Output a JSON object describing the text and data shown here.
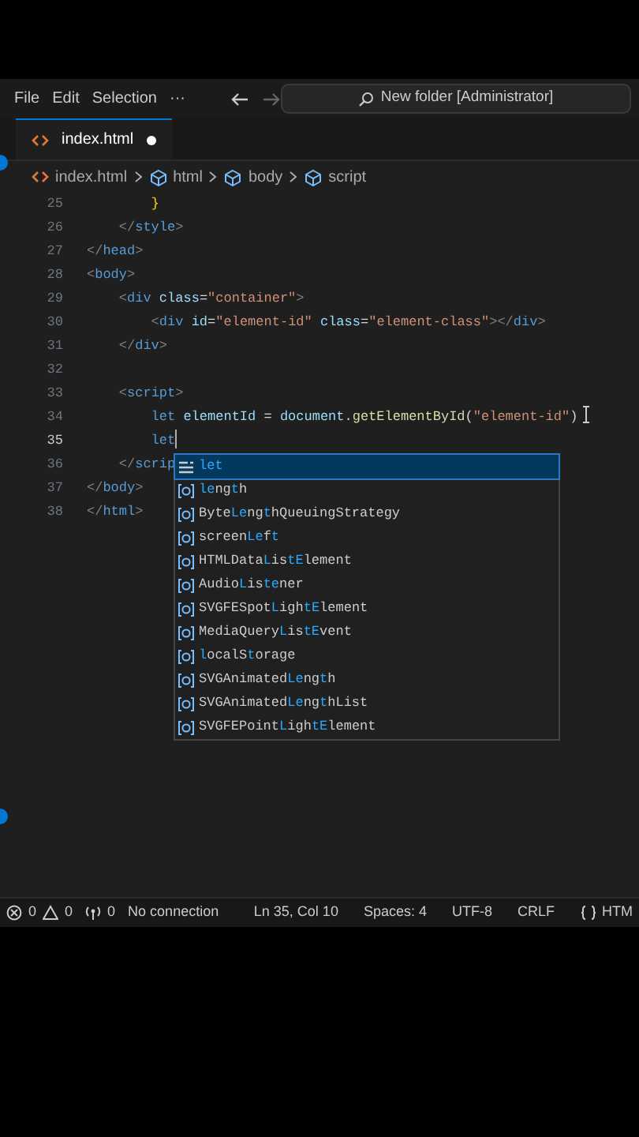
{
  "menu_bar": {
    "items": [
      "File",
      "Edit",
      "Selection",
      "···"
    ],
    "search": {
      "text": "New folder [Administrator]"
    }
  },
  "tabs": [
    {
      "label": "index.html",
      "selected": true,
      "modified": true
    }
  ],
  "breadcrumbs": [
    {
      "kind": "file",
      "label": "index.html"
    },
    {
      "kind": "element",
      "label": "html"
    },
    {
      "kind": "element",
      "label": "body"
    },
    {
      "kind": "element",
      "label": "script"
    }
  ],
  "code_lines": [
    {
      "number": "25",
      "current": false,
      "tokens": [
        {
          "kind": "brace",
          "text": "        }"
        }
      ]
    },
    {
      "number": "26",
      "current": false,
      "tokens": [
        {
          "kind": "bracket",
          "text": "    </"
        },
        {
          "kind": "tag",
          "text": "style"
        },
        {
          "kind": "bracket",
          "text": ">"
        }
      ]
    },
    {
      "number": "27",
      "current": false,
      "tokens": [
        {
          "kind": "bracket",
          "text": "</"
        },
        {
          "kind": "tag",
          "text": "head"
        },
        {
          "kind": "bracket",
          "text": ">"
        }
      ]
    },
    {
      "number": "28",
      "current": false,
      "tokens": [
        {
          "kind": "bracket",
          "text": "<"
        },
        {
          "kind": "tag",
          "text": "body"
        },
        {
          "kind": "bracket",
          "text": ">"
        }
      ]
    },
    {
      "number": "29",
      "current": false,
      "tokens": [
        {
          "kind": "bracket",
          "text": "    <"
        },
        {
          "kind": "tag",
          "text": "div"
        },
        {
          "kind": "attr",
          "text": " class"
        },
        {
          "kind": "punct",
          "text": "="
        },
        {
          "kind": "str",
          "text": "\"container\""
        },
        {
          "kind": "bracket",
          "text": ">"
        }
      ]
    },
    {
      "number": "30",
      "current": false,
      "tokens": [
        {
          "kind": "bracket",
          "text": "        <"
        },
        {
          "kind": "tag",
          "text": "div"
        },
        {
          "kind": "attr",
          "text": " id"
        },
        {
          "kind": "punct",
          "text": "="
        },
        {
          "kind": "str",
          "text": "\"element-id\""
        },
        {
          "kind": "attr",
          "text": " class"
        },
        {
          "kind": "punct",
          "text": "="
        },
        {
          "kind": "str",
          "text": "\"element-class\""
        },
        {
          "kind": "bracket",
          "text": "></"
        },
        {
          "kind": "tag",
          "text": "div"
        },
        {
          "kind": "bracket",
          "text": ">"
        }
      ]
    },
    {
      "number": "31",
      "current": false,
      "tokens": [
        {
          "kind": "bracket",
          "text": "    </"
        },
        {
          "kind": "tag",
          "text": "div"
        },
        {
          "kind": "bracket",
          "text": ">"
        }
      ]
    },
    {
      "number": "32",
      "current": false
    },
    {
      "number": "33",
      "current": false,
      "tokens": [
        {
          "kind": "bracket",
          "text": "    <"
        },
        {
          "kind": "tag",
          "text": "script"
        },
        {
          "kind": "bracket",
          "text": ">"
        }
      ]
    },
    {
      "number": "34",
      "current": false,
      "tokens": [
        {
          "kind": "keyword",
          "text": "        let"
        },
        {
          "kind": "var",
          "text": " elementId"
        },
        {
          "kind": "punct",
          "text": " = "
        },
        {
          "kind": "var",
          "text": "document"
        },
        {
          "kind": "punct",
          "text": "."
        },
        {
          "kind": "func",
          "text": "getElementById"
        },
        {
          "kind": "punct",
          "text": "("
        },
        {
          "kind": "str",
          "text": "\"element-id\""
        },
        {
          "kind": "punct",
          "text": ")"
        }
      ]
    },
    {
      "number": "35",
      "current": true,
      "tokens": [
        {
          "kind": "keyword",
          "text": "        let"
        }
      ]
    },
    {
      "number": "36",
      "current": false,
      "tokens": [
        {
          "kind": "bracket",
          "text": "    </"
        },
        {
          "kind": "tag",
          "text": "scrip"
        }
      ]
    },
    {
      "number": "37",
      "current": false,
      "tokens": [
        {
          "kind": "bracket",
          "text": "</"
        },
        {
          "kind": "tag",
          "text": "body"
        },
        {
          "kind": "bracket",
          "text": ">"
        }
      ]
    },
    {
      "number": "38",
      "current": false,
      "tokens": [
        {
          "kind": "bracket",
          "text": "</"
        },
        {
          "kind": "tag",
          "text": "html"
        },
        {
          "kind": "bracket",
          "text": ">"
        }
      ]
    }
  ],
  "suggestions": [
    {
      "kind": "keyword",
      "selected": true,
      "parts": [
        {
          "text": "let",
          "match": true
        }
      ]
    },
    {
      "kind": "variable",
      "selected": false,
      "parts": [
        {
          "text": "le",
          "match": true
        },
        {
          "text": "ng",
          "match": false
        },
        {
          "text": "t",
          "match": true
        },
        {
          "text": "h",
          "match": false
        }
      ]
    },
    {
      "kind": "variable",
      "selected": false,
      "parts": [
        {
          "text": "Byte",
          "match": false
        },
        {
          "text": "Le",
          "match": true
        },
        {
          "text": "ng",
          "match": false
        },
        {
          "text": "t",
          "match": true
        },
        {
          "text": "hQueuingStrategy",
          "match": false
        }
      ]
    },
    {
      "kind": "variable",
      "selected": false,
      "parts": [
        {
          "text": "screen",
          "match": false
        },
        {
          "text": "Le",
          "match": true
        },
        {
          "text": "f",
          "match": false
        },
        {
          "text": "t",
          "match": true
        }
      ]
    },
    {
      "kind": "variable",
      "selected": false,
      "parts": [
        {
          "text": "HTMLData",
          "match": false
        },
        {
          "text": "L",
          "match": true
        },
        {
          "text": "is",
          "match": false
        },
        {
          "text": "tE",
          "match": true
        },
        {
          "text": "lement",
          "match": false
        }
      ]
    },
    {
      "kind": "variable",
      "selected": false,
      "parts": [
        {
          "text": "Audio",
          "match": false
        },
        {
          "text": "L",
          "match": true
        },
        {
          "text": "is",
          "match": false
        },
        {
          "text": "te",
          "match": true
        },
        {
          "text": "ner",
          "match": false
        }
      ]
    },
    {
      "kind": "variable",
      "selected": false,
      "parts": [
        {
          "text": "SVGFESpot",
          "match": false
        },
        {
          "text": "L",
          "match": true
        },
        {
          "text": "igh",
          "match": false
        },
        {
          "text": "tE",
          "match": true
        },
        {
          "text": "lement",
          "match": false
        }
      ]
    },
    {
      "kind": "variable",
      "selected": false,
      "parts": [
        {
          "text": "MediaQuery",
          "match": false
        },
        {
          "text": "L",
          "match": true
        },
        {
          "text": "is",
          "match": false
        },
        {
          "text": "tE",
          "match": true
        },
        {
          "text": "vent",
          "match": false
        }
      ]
    },
    {
      "kind": "variable",
      "selected": false,
      "parts": [
        {
          "text": "l",
          "match": true
        },
        {
          "text": "ocalS",
          "match": false
        },
        {
          "text": "t",
          "match": true
        },
        {
          "text": "orage",
          "match": false
        }
      ]
    },
    {
      "kind": "variable",
      "selected": false,
      "parts": [
        {
          "text": "SVGAnimated",
          "match": false
        },
        {
          "text": "Le",
          "match": true
        },
        {
          "text": "ng",
          "match": false
        },
        {
          "text": "t",
          "match": true
        },
        {
          "text": "h",
          "match": false
        }
      ]
    },
    {
      "kind": "variable",
      "selected": false,
      "parts": [
        {
          "text": "SVGAnimated",
          "match": false
        },
        {
          "text": "Le",
          "match": true
        },
        {
          "text": "ng",
          "match": false
        },
        {
          "text": "t",
          "match": true
        },
        {
          "text": "hList",
          "match": false
        }
      ]
    },
    {
      "kind": "variable",
      "selected": false,
      "parts": [
        {
          "text": "SVGFEPoint",
          "match": false
        },
        {
          "text": "L",
          "match": true
        },
        {
          "text": "igh",
          "match": false
        },
        {
          "text": "tE",
          "match": true
        },
        {
          "text": "lement",
          "match": false
        }
      ]
    }
  ],
  "status_bar": {
    "errors": "0",
    "warnings": "0",
    "ports": "0",
    "connection": "No connection",
    "position": "Ln 35, Col 10",
    "spaces": "Spaces: 4",
    "encoding": "UTF-8",
    "line_ending": "CRLF",
    "language": "HTM"
  }
}
